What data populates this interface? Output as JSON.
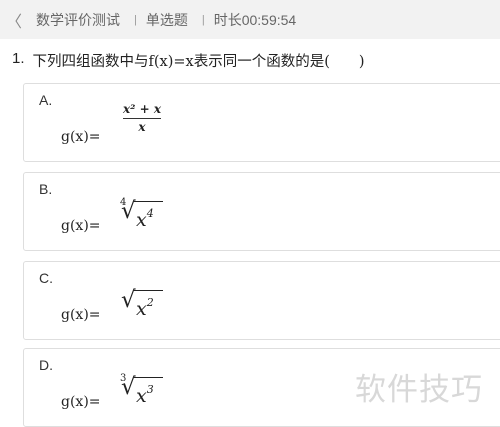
{
  "header": {
    "back_icon": "chevron-left-icon",
    "back_glyph": "〈",
    "exam_title": "数学评价测试",
    "question_type": "单选题",
    "timer_label": "时长",
    "timer_value": "00:59:54"
  },
  "question": {
    "number": "1.",
    "text": "下列四组函数中与f(x)=x表示同一个函数的是(　　)"
  },
  "options": [
    {
      "letter": "A.",
      "prefix": "g(x)=",
      "numerator": "x² + x",
      "denominator": "x"
    },
    {
      "letter": "B.",
      "prefix": "g(x)=",
      "root_index": "4",
      "radicand_base": "x",
      "radicand_exp": "4"
    },
    {
      "letter": "C.",
      "prefix": "g(x)=",
      "root_index": "",
      "radicand_base": "x",
      "radicand_exp": "2"
    },
    {
      "letter": "D.",
      "prefix": "g(x)=",
      "root_index": "3",
      "radicand_base": "x",
      "radicand_exp": "3"
    }
  ],
  "watermark": "软件技巧"
}
